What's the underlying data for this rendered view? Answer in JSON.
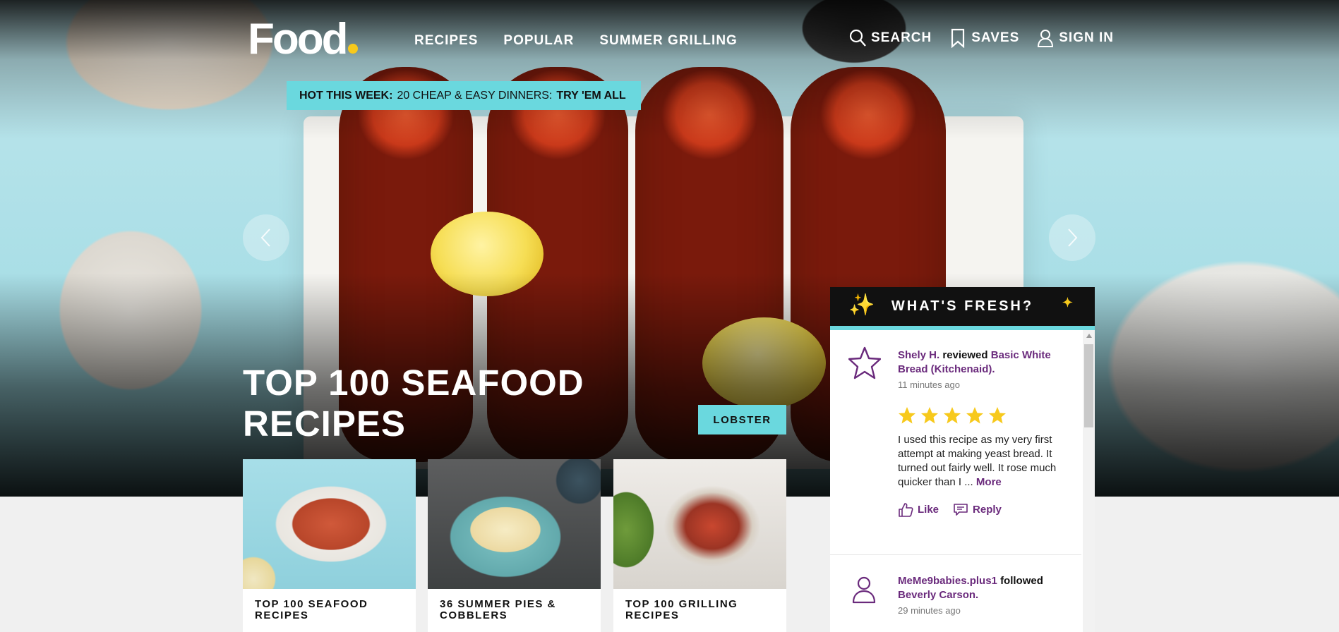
{
  "header": {
    "logo": "Food",
    "nav": [
      "RECIPES",
      "POPULAR",
      "SUMMER GRILLING"
    ],
    "search_label": "SEARCH",
    "saves_label": "SAVES",
    "signin_label": "SIGN IN"
  },
  "hot": {
    "label": "HOT THIS WEEK:",
    "text": "20 CHEAP & EASY DINNERS:",
    "cta": "TRY 'EM ALL"
  },
  "hero": {
    "title": "TOP 100 SEAFOOD RECIPES",
    "tag": "LOBSTER"
  },
  "cards": [
    {
      "caption": "TOP 100 SEAFOOD RECIPES"
    },
    {
      "caption": "36 SUMMER PIES & COBBLERS"
    },
    {
      "caption": "TOP 100 GRILLING RECIPES"
    }
  ],
  "fresh": {
    "title": "WHAT'S FRESH?",
    "items": [
      {
        "user": "Shely H.",
        "action": "reviewed",
        "target": "Basic White Bread (Kitchenaid).",
        "time": "11 minutes ago",
        "rating": 5,
        "text": "I used this recipe as my very first attempt at making yeast bread. It turned out fairly well. It rose much quicker than I ...",
        "more": "More",
        "like": "Like",
        "reply": "Reply"
      },
      {
        "user": "MeMe9babies.plus1",
        "action": "followed",
        "target": "Beverly Carson.",
        "time": "29 minutes ago"
      }
    ]
  },
  "colors": {
    "accent": "#6ad8de",
    "brand_yellow": "#f7c91c",
    "purple": "#6a2a7c"
  }
}
